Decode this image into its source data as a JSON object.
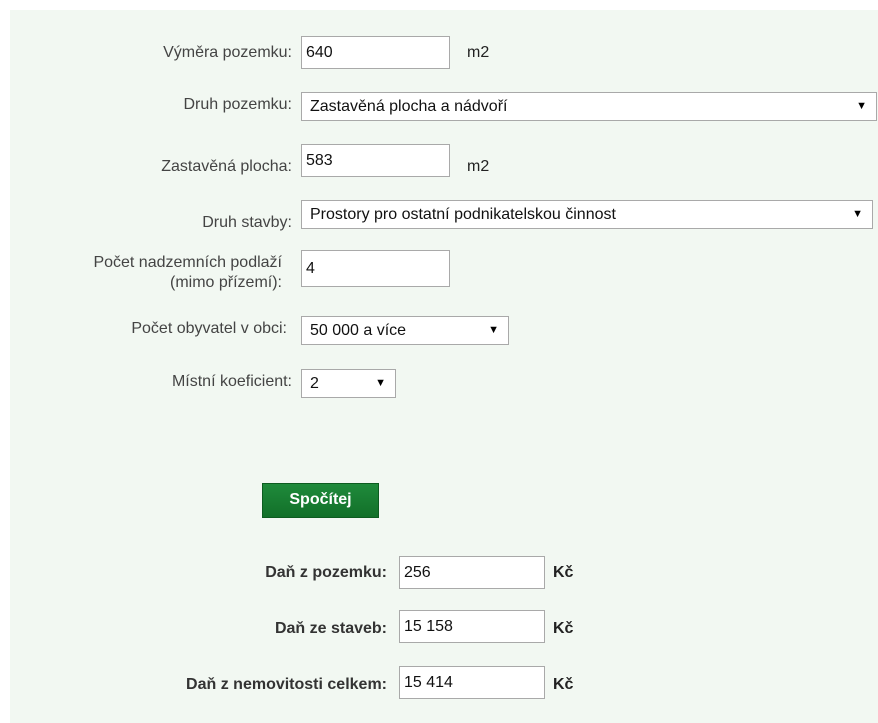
{
  "form": {
    "vymera": {
      "label": "Výměra pozemku:",
      "value": "640",
      "unit": "m2"
    },
    "druh_pozemku": {
      "label": "Druh pozemku:",
      "selected": "Zastavěná plocha a nádvoří"
    },
    "zastavena": {
      "label": "Zastavěná plocha:",
      "value": "583",
      "unit": "m2"
    },
    "druh_stavby": {
      "label": "Druh stavby:",
      "selected": "Prostory pro ostatní podnikatelskou činnost"
    },
    "podlazi": {
      "label_line1": "Počet nadzemních podlaží",
      "label_line2": "(mimo přízemí):",
      "value": "4"
    },
    "obyvatel": {
      "label": "Počet obyvatel v obci:",
      "selected": "50 000 a více"
    },
    "koeficient": {
      "label": "Místní koeficient:",
      "selected": "2"
    }
  },
  "button": {
    "label": "Spočítej"
  },
  "results": {
    "pozemek": {
      "label": "Daň z pozemku:",
      "value": "256",
      "unit": "Kč"
    },
    "stavby": {
      "label": "Daň ze staveb:",
      "value": "15 158",
      "unit": "Kč"
    },
    "celkem": {
      "label": "Daň z nemovitosti celkem:",
      "value": "15 414",
      "unit": "Kč"
    }
  },
  "icons": {
    "dropdown": "▼"
  },
  "colors": {
    "panel_bg": "#f2f8f2",
    "button_bg": "#1a7e35",
    "button_text": "#ffffff"
  }
}
